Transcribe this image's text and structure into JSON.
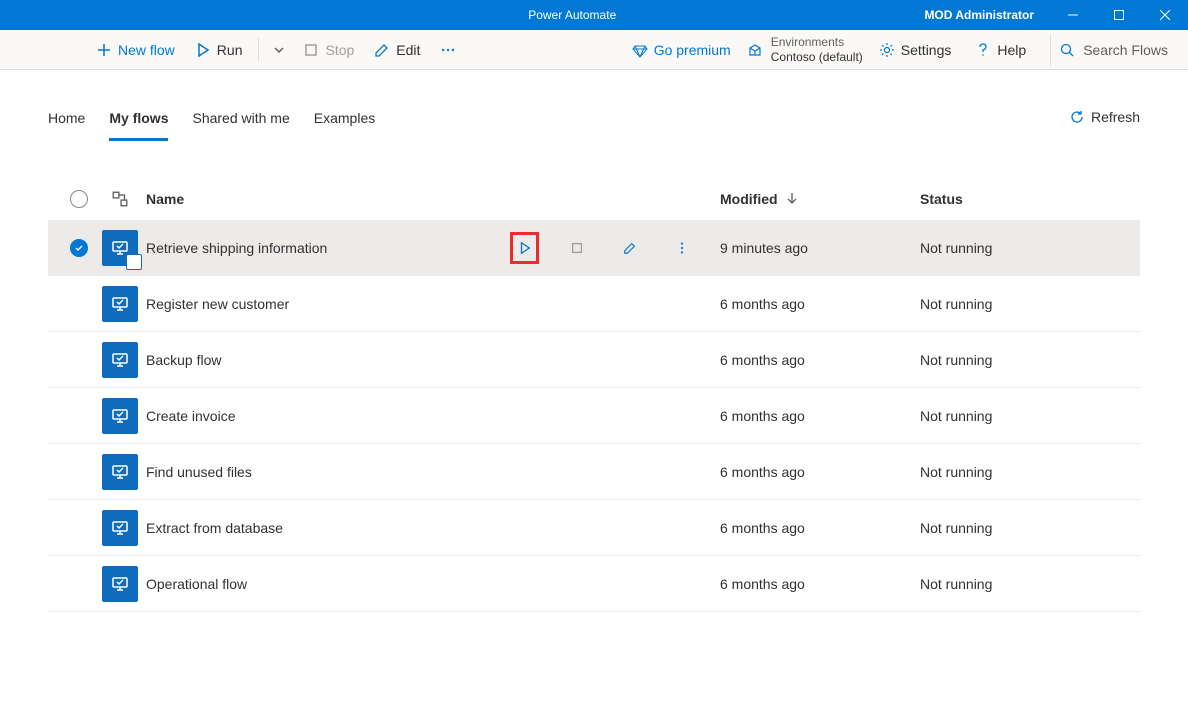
{
  "titlebar": {
    "app_name": "Power Automate",
    "user": "MOD Administrator"
  },
  "commands": {
    "new_flow": "New flow",
    "run": "Run",
    "stop": "Stop",
    "edit": "Edit",
    "go_premium": "Go premium",
    "environments_label": "Environments",
    "environment_value": "Contoso (default)",
    "settings": "Settings",
    "help": "Help",
    "search_placeholder": "Search Flows"
  },
  "tabs": {
    "home": "Home",
    "my_flows": "My flows",
    "shared": "Shared with me",
    "examples": "Examples",
    "refresh": "Refresh"
  },
  "columns": {
    "name": "Name",
    "modified": "Modified",
    "status": "Status"
  },
  "flows": [
    {
      "name": "Retrieve shipping information",
      "modified": "9 minutes ago",
      "status": "Not running",
      "selected": true
    },
    {
      "name": "Register new customer",
      "modified": "6 months ago",
      "status": "Not running",
      "selected": false
    },
    {
      "name": "Backup flow",
      "modified": "6 months ago",
      "status": "Not running",
      "selected": false
    },
    {
      "name": "Create invoice",
      "modified": "6 months ago",
      "status": "Not running",
      "selected": false
    },
    {
      "name": "Find unused files",
      "modified": "6 months ago",
      "status": "Not running",
      "selected": false
    },
    {
      "name": "Extract from database",
      "modified": "6 months ago",
      "status": "Not running",
      "selected": false
    },
    {
      "name": "Operational flow",
      "modified": "6 months ago",
      "status": "Not running",
      "selected": false
    }
  ]
}
